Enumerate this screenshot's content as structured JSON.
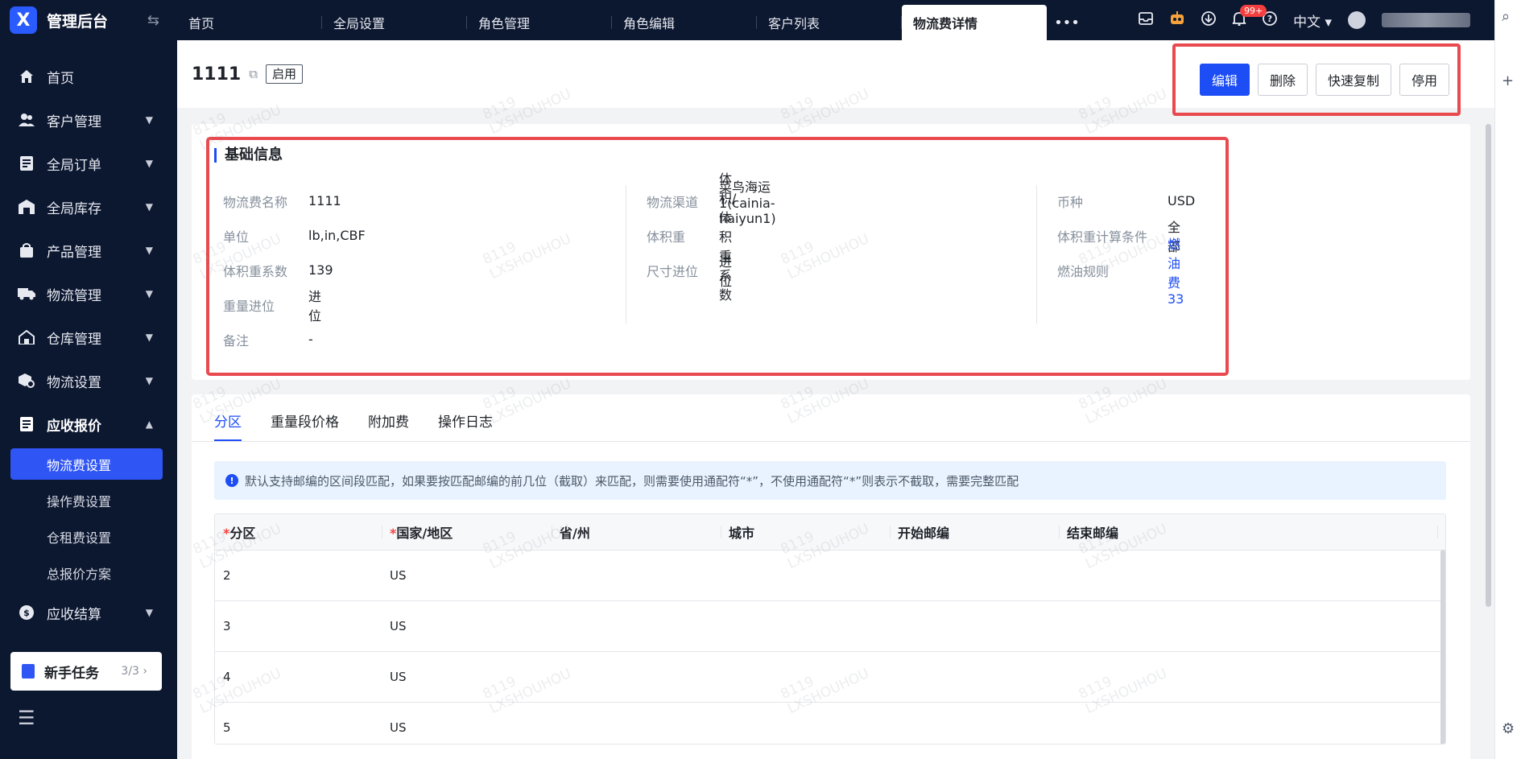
{
  "brand": {
    "logo": "X",
    "title": "管理后台",
    "toggle_icon": "swap-icon"
  },
  "sidebar": {
    "items": [
      {
        "label": "首页",
        "icon": "home-icon",
        "expandable": false
      },
      {
        "label": "客户管理",
        "icon": "users-icon",
        "expandable": true
      },
      {
        "label": "全局订单",
        "icon": "order-icon",
        "expandable": true
      },
      {
        "label": "全局库存",
        "icon": "warehouse-icon",
        "expandable": true
      },
      {
        "label": "产品管理",
        "icon": "bag-icon",
        "expandable": true
      },
      {
        "label": "物流管理",
        "icon": "truck-icon",
        "expandable": true
      },
      {
        "label": "仓库管理",
        "icon": "house-icon",
        "expandable": true
      },
      {
        "label": "物流设置",
        "icon": "box-gear-icon",
        "expandable": true
      },
      {
        "label": "应收报价",
        "icon": "document-icon",
        "expandable": true,
        "open": true
      }
    ],
    "sub_items": [
      {
        "label": "物流费设置",
        "active": true
      },
      {
        "label": "操作费设置"
      },
      {
        "label": "仓租费设置"
      },
      {
        "label": "总报价方案"
      }
    ],
    "bottom_item": {
      "label": "应收结算",
      "icon": "dollar-icon"
    },
    "task": {
      "label": "新手任务",
      "count": "3/3"
    }
  },
  "tabs": [
    {
      "label": "首页"
    },
    {
      "label": "全局设置"
    },
    {
      "label": "角色管理"
    },
    {
      "label": "角色编辑"
    },
    {
      "label": "客户列表"
    },
    {
      "label": "物流费详情",
      "active": true
    }
  ],
  "topbar": {
    "notification_count": "99+",
    "language": "中文"
  },
  "page": {
    "title": "1111",
    "status": "启用",
    "actions": {
      "edit": "编辑",
      "delete": "删除",
      "quick_copy": "快速复制",
      "disable": "停用"
    }
  },
  "basic_info": {
    "title": "基础信息",
    "col1": [
      {
        "label": "物流费名称",
        "value": "1111"
      },
      {
        "label": "单位",
        "value": "lb,in,CBF"
      },
      {
        "label": "体积重系数",
        "value": "139"
      },
      {
        "label": "重量进位",
        "value": "进位"
      },
      {
        "label": "备注",
        "value": "-"
      }
    ],
    "col2": [
      {
        "label": "物流渠道",
        "value": "菜鸟海运1(cainia-haiyun1)"
      },
      {
        "label": "体积重",
        "value": "体积/体积重系数"
      },
      {
        "label": "尺寸进位",
        "value": "进位"
      }
    ],
    "col3": [
      {
        "label": "币种",
        "value": "USD"
      },
      {
        "label": "体积重计算条件",
        "value": "全部"
      },
      {
        "label": "燃油规则",
        "value": "燃油费33"
      }
    ]
  },
  "subtabs": [
    {
      "label": "分区",
      "active": true
    },
    {
      "label": "重量段价格"
    },
    {
      "label": "附加费"
    },
    {
      "label": "操作日志"
    }
  ],
  "notice": "默认支持邮编的区间段匹配，如果要按匹配邮编的前几位（截取）来匹配，则需要使用通配符“*”，不使用通配符“*”则表示不截取，需要完整匹配",
  "table": {
    "columns": [
      "分区",
      "国家/地区",
      "省/州",
      "城市",
      "开始邮编",
      "结束邮编"
    ],
    "required_mark": "*",
    "rows": [
      {
        "zone": "2",
        "country": "US"
      },
      {
        "zone": "3",
        "country": "US"
      },
      {
        "zone": "4",
        "country": "US"
      },
      {
        "zone": "5",
        "country": "US"
      }
    ]
  },
  "watermark": {
    "line1": "8119",
    "line2": "LXSHOUHOU"
  },
  "colors": {
    "primary": "#1d4df5",
    "sidebar": "#0c1730",
    "highlight": "#e84a4f"
  }
}
